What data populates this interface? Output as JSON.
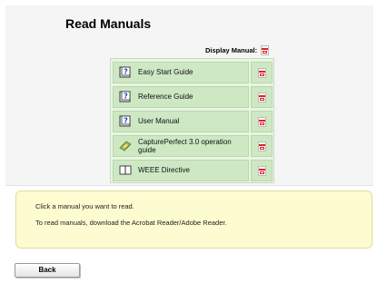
{
  "header": {
    "title": "Read Manuals",
    "display_label": "Display Manual:",
    "display_icon": "pdf-icon"
  },
  "manuals": [
    {
      "label": "Easy Start Guide",
      "icon": "help-book-icon"
    },
    {
      "label": "Reference Guide",
      "icon": "help-book-icon"
    },
    {
      "label": "User Manual",
      "icon": "help-book-icon"
    },
    {
      "label": "CapturePerfect 3.0 operation guide",
      "icon": "captureperfect-icon"
    },
    {
      "label": "WEEE Directive",
      "icon": "open-book-icon"
    }
  ],
  "info": {
    "line1": "Click a manual you want to read.",
    "line2": "To read manuals, download the Acrobat Reader/Adobe Reader."
  },
  "footer": {
    "back_label": "Back"
  },
  "colors": {
    "table_bg": "#e6f7dd",
    "cell_bg": "#cde8c3",
    "info_bg": "#fdfbd0",
    "pdf_red": "#d22222"
  }
}
